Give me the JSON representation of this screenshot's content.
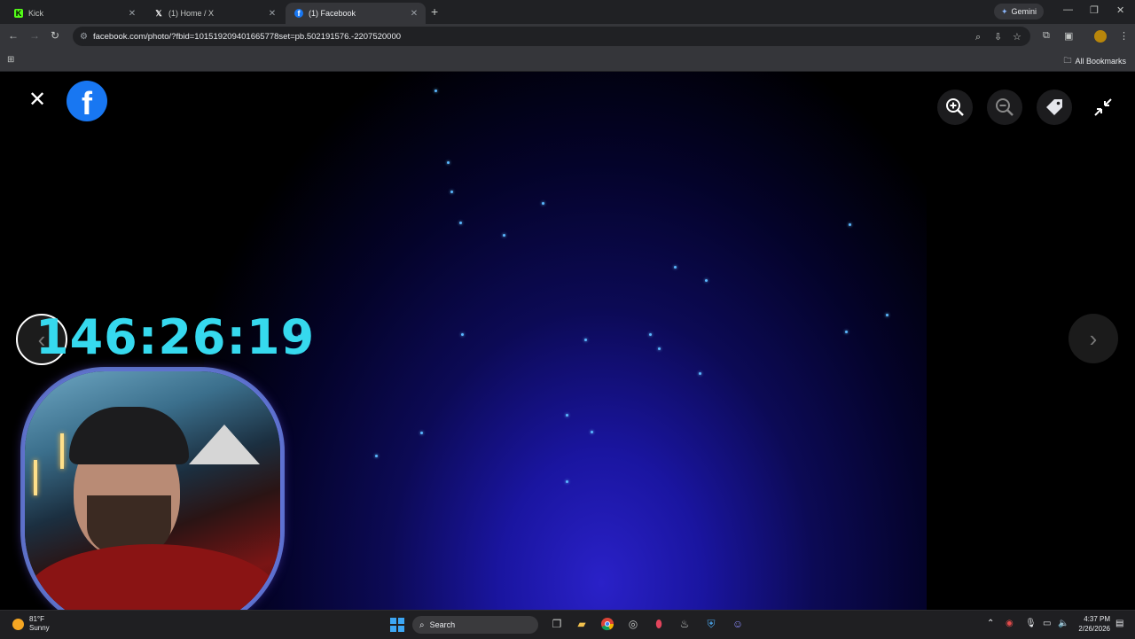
{
  "browser": {
    "tabs": [
      {
        "title": "Kick",
        "favicon": "kick-icon",
        "active": false
      },
      {
        "title": "(1) Home / X",
        "favicon": "x-icon",
        "active": false
      },
      {
        "title": "(1) Facebook",
        "favicon": "facebook-icon",
        "active": true
      }
    ],
    "new_tab": "+",
    "gemini_label": "Gemini",
    "url": "facebook.com/photo/?fbid=101519209401665778set=pb.502191576.-2207520000",
    "bookmarks_label": "All Bookmarks"
  },
  "viewer": {
    "close_glyph": "✕",
    "logo_letter": "f",
    "prev_glyph": "‹",
    "next_glyph": "›",
    "accent": "#1877f2"
  },
  "overlay": {
    "timer": "146:26:19",
    "timer_color": "#36d9ee"
  },
  "taskbar": {
    "weather_temp": "81°F",
    "weather_desc": "Sunny",
    "search_placeholder": "Search",
    "time": "4:37 PM",
    "date": "2/26/2026"
  }
}
